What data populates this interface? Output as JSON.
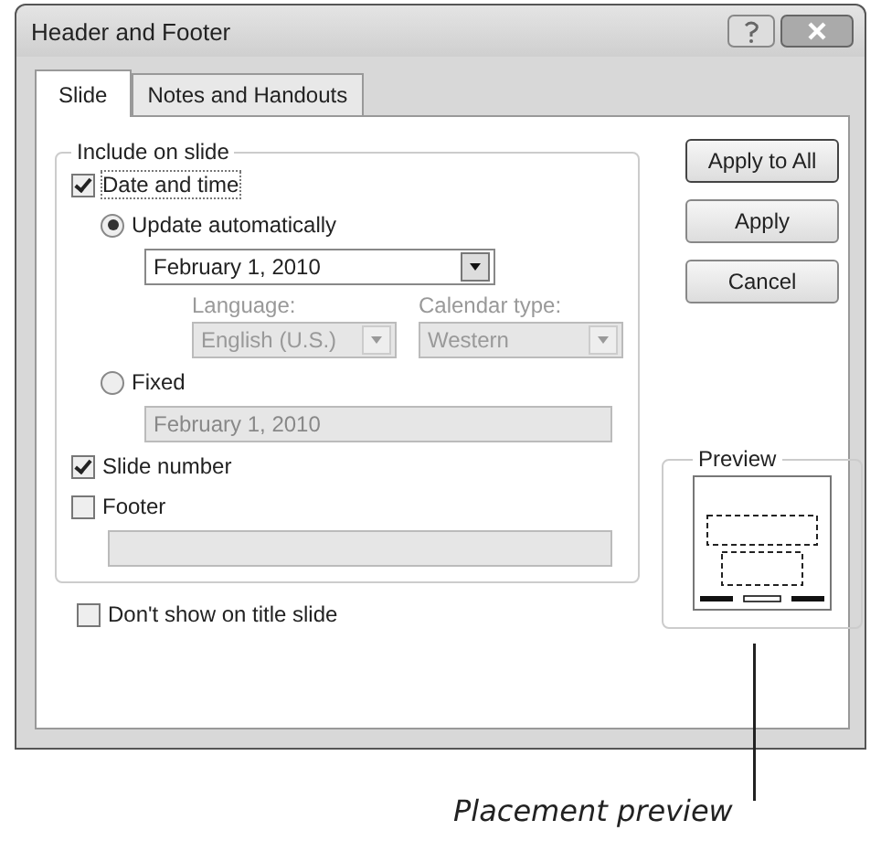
{
  "window": {
    "title": "Header and Footer"
  },
  "tabs": [
    {
      "label": "Slide",
      "selected": true
    },
    {
      "label": "Notes and Handouts",
      "selected": false
    }
  ],
  "include_on_slide": {
    "title": "Include on slide",
    "date_and_time": {
      "label": "Date and time",
      "checked": true,
      "update_automatically": {
        "label": "Update automatically",
        "selected": true,
        "value": "February 1, 2010",
        "disabled": false
      },
      "language": {
        "label": "Language:",
        "value": "English (U.S.)",
        "disabled": true
      },
      "calendar_type": {
        "label": "Calendar type:",
        "value": "Western",
        "disabled": true
      },
      "fixed": {
        "label": "Fixed",
        "selected": false,
        "value": "February 1, 2010",
        "disabled": true
      }
    },
    "slide_number": {
      "label": "Slide number",
      "checked": true
    },
    "footer": {
      "label": "Footer",
      "checked": false,
      "disabled": true
    }
  },
  "dont_show_on_title_slide": {
    "label": "Don't show on title slide",
    "checked": false
  },
  "buttons": [
    {
      "label": "Apply to All"
    },
    {
      "label": "Apply"
    },
    {
      "label": "Cancel"
    }
  ],
  "preview": {
    "title": "Preview"
  },
  "callout": {
    "label": "Placement preview"
  }
}
